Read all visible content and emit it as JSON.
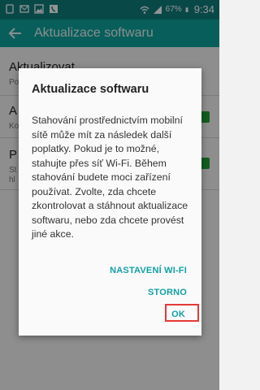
{
  "status_bar": {
    "battery": "67%",
    "time": "9:34",
    "icons": [
      "sim-card-icon",
      "message-icon",
      "image-icon",
      "phone-icon",
      "wifi-icon",
      "signal-icon",
      "battery-icon"
    ]
  },
  "app_bar": {
    "title": "Aktualizace softwaru"
  },
  "background_list": {
    "items": [
      {
        "title": "Aktualizovat",
        "subtitle": "Po"
      },
      {
        "title": "A",
        "subtitle": "Ko"
      },
      {
        "title": "P",
        "subtitle": "St"
      },
      {
        "title": "",
        "subtitle": "hl"
      }
    ]
  },
  "dialog": {
    "title": "Aktualizace softwaru",
    "message": "Stahování prostřednictvím mobilní sítě může mít za následek další poplatky. Pokud je to možné, stahujte přes síť Wi-Fi. Během stahování budete moci zařízení používat. Zvolte, zda chcete zkontrolovat a stáhnout aktualizace softwaru, nebo zda chcete provést jiné akce.",
    "buttons": {
      "wifi_settings": "NASTAVENÍ WI-FI",
      "cancel": "STORNO",
      "ok": "OK"
    }
  },
  "colors": {
    "status_bar": "#0e7f7c",
    "app_bar": "#0fa29d",
    "button_text": "#11a0a4",
    "highlight": "#e53935"
  }
}
